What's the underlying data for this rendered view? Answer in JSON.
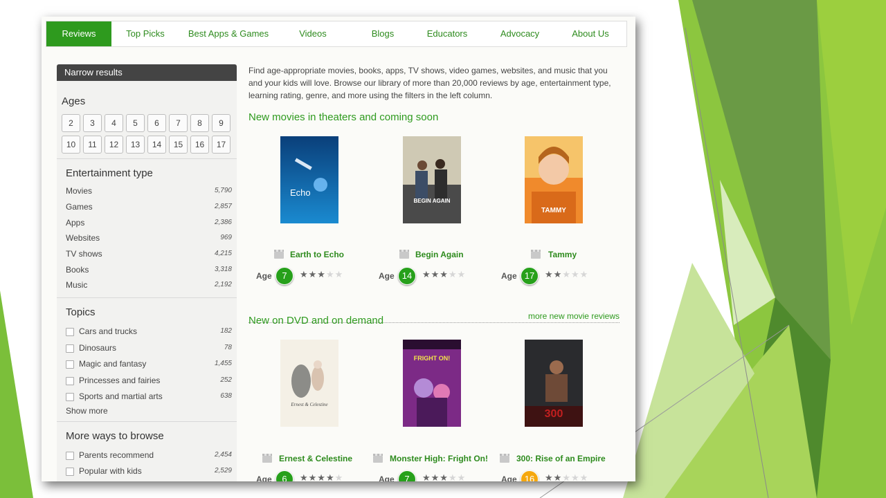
{
  "colors": {
    "accent": "#2e9a1e",
    "badge_green": "#27a01b",
    "badge_orange": "#f5a80f"
  },
  "nav": [
    {
      "label": "Reviews",
      "active": true
    },
    {
      "label": "Top Picks"
    },
    {
      "label": "Best Apps & Games"
    },
    {
      "label": "Videos"
    },
    {
      "label": "Blogs"
    },
    {
      "label": "Educators"
    },
    {
      "label": "Advocacy"
    },
    {
      "label": "About Us"
    }
  ],
  "sidebar": {
    "header": "Narrow results",
    "ages_title": "Ages",
    "ages": [
      "2",
      "3",
      "4",
      "5",
      "6",
      "7",
      "8",
      "9",
      "10",
      "11",
      "12",
      "13",
      "14",
      "15",
      "16",
      "17"
    ],
    "entertainment_title": "Entertainment type",
    "entertainment": [
      {
        "label": "Movies",
        "count": "5,790"
      },
      {
        "label": "Games",
        "count": "2,857"
      },
      {
        "label": "Apps",
        "count": "2,386"
      },
      {
        "label": "Websites",
        "count": "969"
      },
      {
        "label": "TV shows",
        "count": "4,215"
      },
      {
        "label": "Books",
        "count": "3,318"
      },
      {
        "label": "Music",
        "count": "2,192"
      }
    ],
    "topics_title": "Topics",
    "topics": [
      {
        "label": "Cars and trucks",
        "count": "182"
      },
      {
        "label": "Dinosaurs",
        "count": "78"
      },
      {
        "label": "Magic and fantasy",
        "count": "1,455"
      },
      {
        "label": "Princesses and fairies",
        "count": "252"
      },
      {
        "label": "Sports and martial arts",
        "count": "638"
      }
    ],
    "show_more": "Show more",
    "more_ways_title": "More ways to browse",
    "more_ways": [
      {
        "label": "Parents recommend",
        "count": "2,454"
      },
      {
        "label": "Popular with kids",
        "count": "2,529"
      }
    ]
  },
  "main": {
    "intro": "Find age-appropriate movies, books, apps, TV shows, video games, websites, and music that you and your kids will love. Browse our library of more than 20,000 reviews by age, entertainment type, learning rating, genre, and more using the filters in the left column.",
    "section1": {
      "title": "New movies in theaters and coming soon",
      "more": "more new movie reviews",
      "items": [
        {
          "title": "Earth to Echo",
          "age_label": "Age",
          "age": "7",
          "stars": 3,
          "badge": "green",
          "poster_text": "Echo"
        },
        {
          "title": "Begin Again",
          "age_label": "Age",
          "age": "14",
          "stars": 3,
          "badge": "green",
          "poster_text": "BEGIN AGAIN"
        },
        {
          "title": "Tammy",
          "age_label": "Age",
          "age": "17",
          "stars": 2,
          "badge": "green",
          "poster_text": "TAMMY"
        }
      ]
    },
    "section2": {
      "title": "New on DVD and on demand",
      "items": [
        {
          "title": "Ernest & Celestine",
          "age_label": "Age",
          "age": "6",
          "stars": 4,
          "badge": "green",
          "poster_text": "Ernest & Celestine"
        },
        {
          "title": "Monster High: Fright On!",
          "age_label": "Age",
          "age": "7",
          "stars": 3,
          "badge": "green",
          "poster_text": "FRIGHT ON!"
        },
        {
          "title": "300: Rise of an Empire",
          "age_label": "Age",
          "age": "16",
          "stars": 2,
          "badge": "orange",
          "poster_text": "300"
        }
      ]
    }
  }
}
